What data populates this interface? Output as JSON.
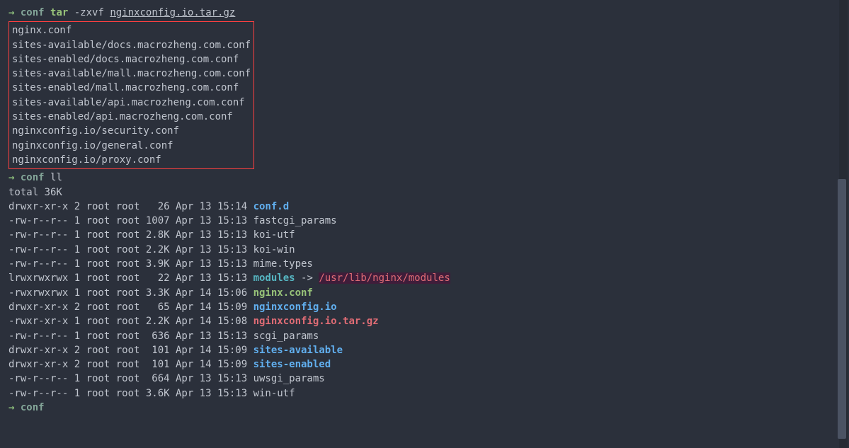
{
  "prompt": {
    "arrow": "→ ",
    "dir": "conf",
    "cmd1": "tar",
    "cmd1_args": " -zxvf ",
    "cmd1_file": "nginxconfig.io.tar.gz",
    "cmd2": "ll"
  },
  "tar_output": [
    "nginx.conf",
    "sites-available/docs.macrozheng.com.conf",
    "sites-enabled/docs.macrozheng.com.conf",
    "sites-available/mall.macrozheng.com.conf",
    "sites-enabled/mall.macrozheng.com.conf",
    "sites-available/api.macrozheng.com.conf",
    "sites-enabled/api.macrozheng.com.conf",
    "nginxconfig.io/security.conf",
    "nginxconfig.io/general.conf",
    "nginxconfig.io/proxy.conf"
  ],
  "ll": {
    "total": "total 36K",
    "rows": [
      {
        "perm": "drwxr-xr-x",
        "n": "2",
        "o": "root",
        "g": "root",
        "size": "  26",
        "date": "Apr 13 15:14",
        "name": "conf.d",
        "cls": "dir"
      },
      {
        "perm": "-rw-r--r--",
        "n": "1",
        "o": "root",
        "g": "root",
        "size": "1007",
        "date": "Apr 13 15:13",
        "name": "fastcgi_params",
        "cls": ""
      },
      {
        "perm": "-rw-r--r--",
        "n": "1",
        "o": "root",
        "g": "root",
        "size": "2.8K",
        "date": "Apr 13 15:13",
        "name": "koi-utf",
        "cls": ""
      },
      {
        "perm": "-rw-r--r--",
        "n": "1",
        "o": "root",
        "g": "root",
        "size": "2.2K",
        "date": "Apr 13 15:13",
        "name": "koi-win",
        "cls": ""
      },
      {
        "perm": "-rw-r--r--",
        "n": "1",
        "o": "root",
        "g": "root",
        "size": "3.9K",
        "date": "Apr 13 15:13",
        "name": "mime.types",
        "cls": ""
      },
      {
        "perm": "lrwxrwxrwx",
        "n": "1",
        "o": "root",
        "g": "root",
        "size": "  22",
        "date": "Apr 13 15:13",
        "name": "modules",
        "cls": "symlink",
        "arrow": " -> ",
        "target": "/usr/lib/nginx/modules"
      },
      {
        "perm": "-rwxrwxrwx",
        "n": "1",
        "o": "root",
        "g": "root",
        "size": "3.3K",
        "date": "Apr 14 15:06",
        "name": "nginx.conf",
        "cls": "exec"
      },
      {
        "perm": "drwxr-xr-x",
        "n": "2",
        "o": "root",
        "g": "root",
        "size": "  65",
        "date": "Apr 14 15:09",
        "name": "nginxconfig.io",
        "cls": "dir"
      },
      {
        "perm": "-rwxr-xr-x",
        "n": "1",
        "o": "root",
        "g": "root",
        "size": "2.2K",
        "date": "Apr 14 15:08",
        "name": "nginxconfig.io.tar.gz",
        "cls": "archive"
      },
      {
        "perm": "-rw-r--r--",
        "n": "1",
        "o": "root",
        "g": "root",
        "size": " 636",
        "date": "Apr 13 15:13",
        "name": "scgi_params",
        "cls": ""
      },
      {
        "perm": "drwxr-xr-x",
        "n": "2",
        "o": "root",
        "g": "root",
        "size": " 101",
        "date": "Apr 14 15:09",
        "name": "sites-available",
        "cls": "dir"
      },
      {
        "perm": "drwxr-xr-x",
        "n": "2",
        "o": "root",
        "g": "root",
        "size": " 101",
        "date": "Apr 14 15:09",
        "name": "sites-enabled",
        "cls": "dir"
      },
      {
        "perm": "-rw-r--r--",
        "n": "1",
        "o": "root",
        "g": "root",
        "size": " 664",
        "date": "Apr 13 15:13",
        "name": "uwsgi_params",
        "cls": ""
      },
      {
        "perm": "-rw-r--r--",
        "n": "1",
        "o": "root",
        "g": "root",
        "size": "3.6K",
        "date": "Apr 13 15:13",
        "name": "win-utf",
        "cls": ""
      }
    ]
  }
}
